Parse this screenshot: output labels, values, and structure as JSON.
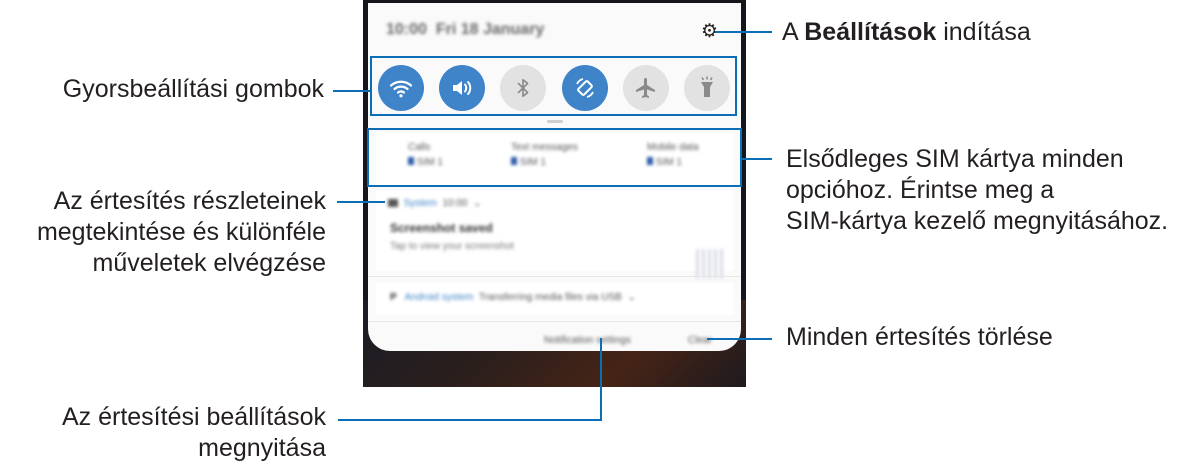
{
  "phone": {
    "status_bar": {
      "time": "10:00",
      "date": "Fri 18 January"
    },
    "sim_info": [
      {
        "label": "Calls",
        "sim": "SIM 1"
      },
      {
        "label": "Text messages",
        "sim": "SIM 1"
      },
      {
        "label": "Mobile data",
        "sim": "SIM 1"
      }
    ],
    "notification": {
      "app": "System",
      "time": "10:00",
      "title": "Screenshot saved",
      "text": "Tap to view your screenshot"
    },
    "android_notification": {
      "app": "Android system",
      "text": "Transferring media files via USB"
    },
    "footer": {
      "settings_label": "Notification settings",
      "clear_label": "Clear"
    }
  },
  "callouts": {
    "settings_prefix": "A ",
    "settings_bold": "Beállítások",
    "settings_suffix": " indítása",
    "quick_settings": "Gyorsbeállítási gombok",
    "sim_line1": "Elsődleges SIM kártya minden",
    "sim_line2": "opcióhoz. Érintse meg a",
    "sim_line3": "SIM-kártya kezelő megnyitásához.",
    "notif_line1": "Az értesítés részleteinek",
    "notif_line2": "megtekintése és különféle",
    "notif_line3": "műveletek elvégzése",
    "clear_all": "Minden értesítés törlése",
    "open_settings_line1": "Az értesítési beállítások",
    "open_settings_line2": "megnyitása"
  },
  "colors": {
    "accent": "#0a6fb7",
    "toggle_on": "#3f83c8",
    "toggle_off": "#e2e2e2"
  }
}
